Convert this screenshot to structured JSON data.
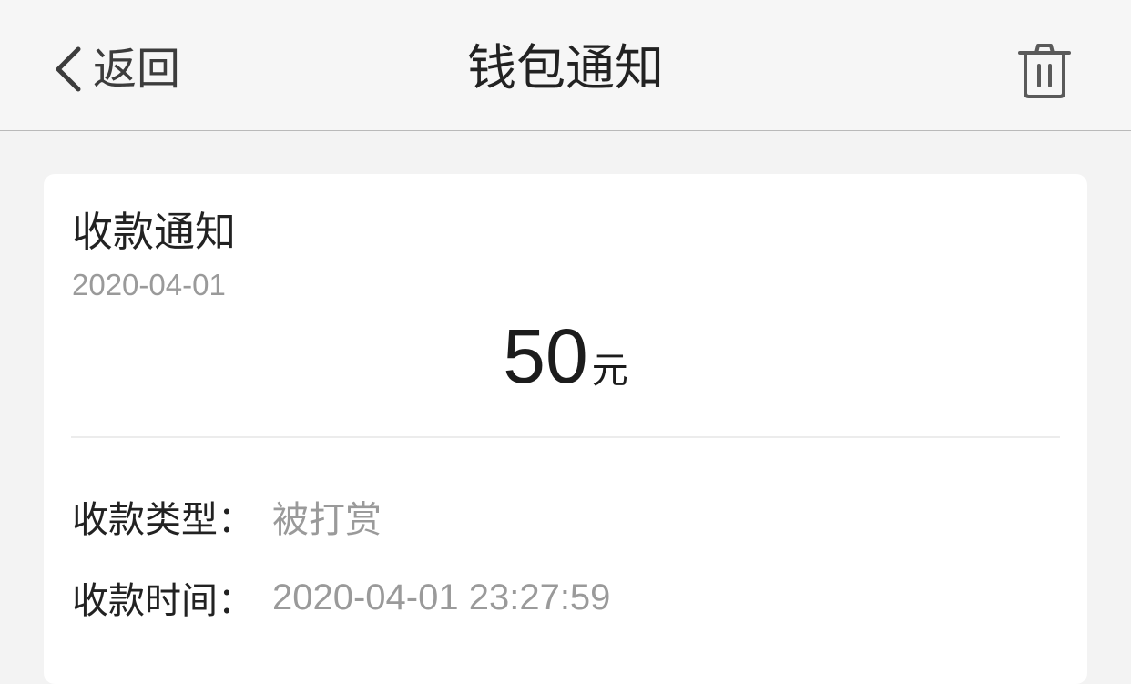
{
  "nav": {
    "back_label": "返回",
    "title": "钱包通知"
  },
  "card": {
    "title": "收款通知",
    "date": "2020-04-01",
    "amount": "50",
    "amount_unit": "元",
    "rows": [
      {
        "label": "收款类型：",
        "value": "被打赏"
      },
      {
        "label": "收款时间：",
        "value": "2020-04-01 23:27:59"
      }
    ]
  },
  "icons": {
    "back": "chevron-left-icon",
    "delete": "trash-icon"
  }
}
